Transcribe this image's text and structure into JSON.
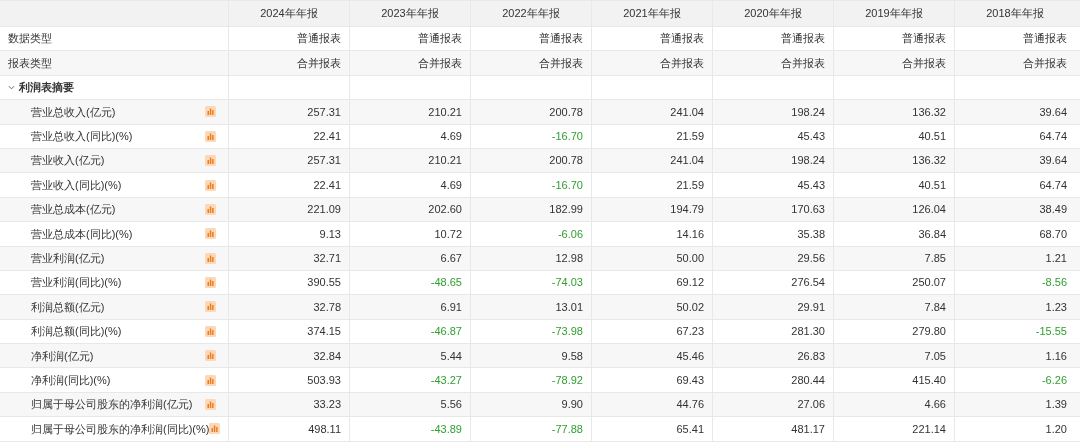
{
  "table": {
    "columns": [
      "2024年年报",
      "2023年年报",
      "2022年年报",
      "2021年年报",
      "2020年年报",
      "2019年年报",
      "2018年年报"
    ],
    "meta_rows": [
      {
        "label": "数据类型",
        "values": [
          "普通报表",
          "普通报表",
          "普通报表",
          "普通报表",
          "普通报表",
          "普通报表",
          "普通报表"
        ]
      },
      {
        "label": "报表类型",
        "values": [
          "合并报表",
          "合并报表",
          "合并报表",
          "合并报表",
          "合并报表",
          "合并报表",
          "合并报表"
        ]
      }
    ],
    "section": {
      "label": "利润表摘要",
      "expanded": true,
      "rows": [
        {
          "label": "营业总收入(亿元)",
          "values": [
            "257.31",
            "210.21",
            "200.78",
            "241.04",
            "198.24",
            "136.32",
            "39.64"
          ],
          "negative": [
            false,
            false,
            false,
            false,
            false,
            false,
            false
          ]
        },
        {
          "label": "营业总收入(同比)(%)",
          "values": [
            "22.41",
            "4.69",
            "-16.70",
            "21.59",
            "45.43",
            "40.51",
            "64.74"
          ],
          "negative": [
            false,
            false,
            true,
            false,
            false,
            false,
            false
          ]
        },
        {
          "label": "营业收入(亿元)",
          "values": [
            "257.31",
            "210.21",
            "200.78",
            "241.04",
            "198.24",
            "136.32",
            "39.64"
          ],
          "negative": [
            false,
            false,
            false,
            false,
            false,
            false,
            false
          ]
        },
        {
          "label": "营业收入(同比)(%)",
          "values": [
            "22.41",
            "4.69",
            "-16.70",
            "21.59",
            "45.43",
            "40.51",
            "64.74"
          ],
          "negative": [
            false,
            false,
            true,
            false,
            false,
            false,
            false
          ]
        },
        {
          "label": "营业总成本(亿元)",
          "values": [
            "221.09",
            "202.60",
            "182.99",
            "194.79",
            "170.63",
            "126.04",
            "38.49"
          ],
          "negative": [
            false,
            false,
            false,
            false,
            false,
            false,
            false
          ]
        },
        {
          "label": "营业总成本(同比)(%)",
          "values": [
            "9.13",
            "10.72",
            "-6.06",
            "14.16",
            "35.38",
            "36.84",
            "68.70"
          ],
          "negative": [
            false,
            false,
            true,
            false,
            false,
            false,
            false
          ]
        },
        {
          "label": "营业利润(亿元)",
          "values": [
            "32.71",
            "6.67",
            "12.98",
            "50.00",
            "29.56",
            "7.85",
            "1.21"
          ],
          "negative": [
            false,
            false,
            false,
            false,
            false,
            false,
            false
          ]
        },
        {
          "label": "营业利润(同比)(%)",
          "values": [
            "390.55",
            "-48.65",
            "-74.03",
            "69.12",
            "276.54",
            "250.07",
            "-8.56"
          ],
          "negative": [
            false,
            true,
            true,
            false,
            false,
            false,
            true
          ]
        },
        {
          "label": "利润总额(亿元)",
          "values": [
            "32.78",
            "6.91",
            "13.01",
            "50.02",
            "29.91",
            "7.84",
            "1.23"
          ],
          "negative": [
            false,
            false,
            false,
            false,
            false,
            false,
            false
          ]
        },
        {
          "label": "利润总额(同比)(%)",
          "values": [
            "374.15",
            "-46.87",
            "-73.98",
            "67.23",
            "281.30",
            "279.80",
            "-15.55"
          ],
          "negative": [
            false,
            true,
            true,
            false,
            false,
            false,
            true
          ]
        },
        {
          "label": "净利润(亿元)",
          "values": [
            "32.84",
            "5.44",
            "9.58",
            "45.46",
            "26.83",
            "7.05",
            "1.16"
          ],
          "negative": [
            false,
            false,
            false,
            false,
            false,
            false,
            false
          ]
        },
        {
          "label": "净利润(同比)(%)",
          "values": [
            "503.93",
            "-43.27",
            "-78.92",
            "69.43",
            "280.44",
            "415.40",
            "-6.26"
          ],
          "negative": [
            false,
            true,
            true,
            false,
            false,
            false,
            true
          ]
        },
        {
          "label": "归属于母公司股东的净利润(亿元)",
          "values": [
            "33.23",
            "5.56",
            "9.90",
            "44.76",
            "27.06",
            "4.66",
            "1.39"
          ],
          "negative": [
            false,
            false,
            false,
            false,
            false,
            false,
            false
          ]
        },
        {
          "label": "归属于母公司股东的净利润(同比)(%)",
          "values": [
            "498.11",
            "-43.89",
            "-77.88",
            "65.41",
            "481.17",
            "221.14",
            "1.20"
          ],
          "negative": [
            false,
            true,
            true,
            false,
            false,
            false,
            false
          ]
        }
      ]
    }
  }
}
